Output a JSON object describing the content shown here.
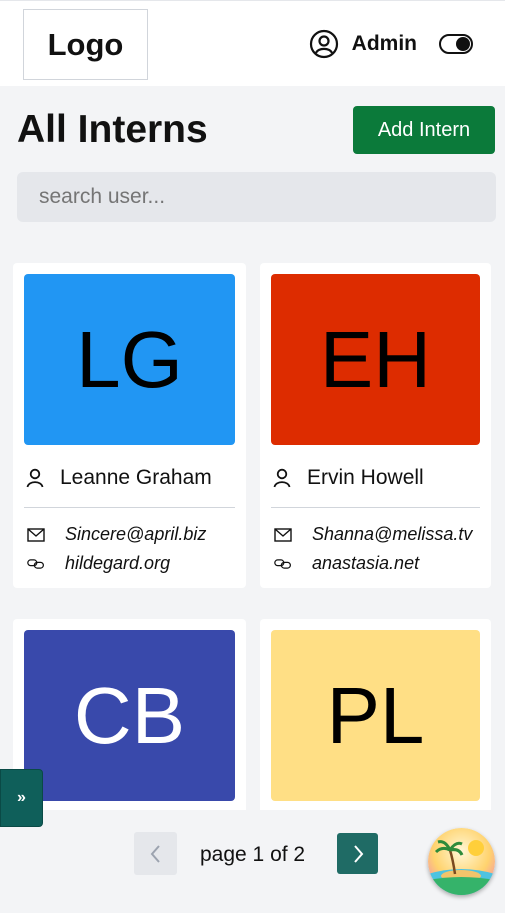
{
  "header": {
    "logo": "Logo",
    "user_icon": "user-circle-icon",
    "user_name": "Admin",
    "theme_toggle_icon": "toggle-icon"
  },
  "main": {
    "title": "All Interns",
    "add_button_label": "Add Intern",
    "search_placeholder": "search user..."
  },
  "interns": [
    {
      "initials": "LG",
      "name": "Leanne Graham",
      "email": "Sincere@april.biz",
      "website": "hildegard.org",
      "color": "#2196f3",
      "text_color": "#000000"
    },
    {
      "initials": "EH",
      "name": "Ervin Howell",
      "email": "Shanna@melissa.tv",
      "website": "anastasia.net",
      "color": "#dd2c00",
      "text_color": "#000000"
    },
    {
      "initials": "CB",
      "name": "",
      "email": "",
      "website": "",
      "color": "#3949ab",
      "text_color": "#ffffff"
    },
    {
      "initials": "PL",
      "name": "",
      "email": "",
      "website": "",
      "color": "#ffdf85",
      "text_color": "#000000"
    }
  ],
  "sidebar_toggle": {
    "label": "»"
  },
  "pagination": {
    "label": "page 1 of 2",
    "prev_icon": "chevron-left-icon",
    "next_icon": "chevron-right-icon"
  },
  "colors": {
    "accent_green": "#0b7a3a",
    "teal": "#1f6b65",
    "background": "#f3f4f6"
  }
}
